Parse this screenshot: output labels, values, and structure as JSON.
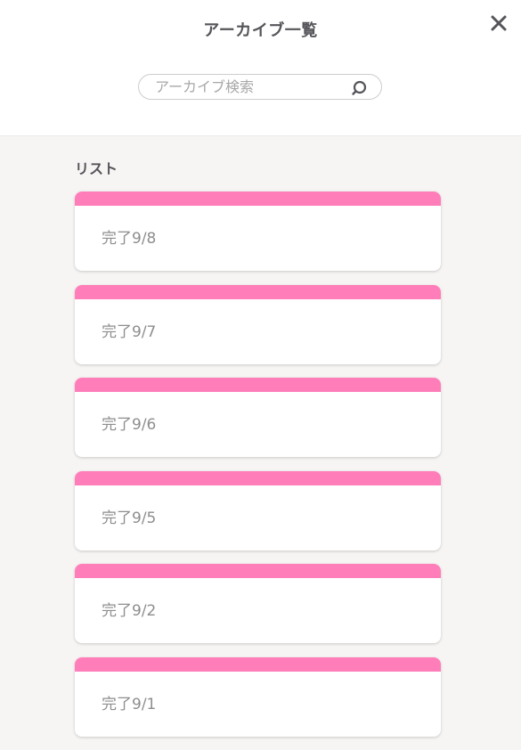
{
  "header": {
    "title": "アーカイブ一覧",
    "close_icon": "close-icon"
  },
  "search": {
    "placeholder": "アーカイブ検索",
    "value": "",
    "icon": "search-icon"
  },
  "list": {
    "heading": "リスト",
    "accent_color": "#ff7eb9",
    "items": [
      {
        "label": "完了9/8"
      },
      {
        "label": "完了9/7"
      },
      {
        "label": "完了9/6"
      },
      {
        "label": "完了9/5"
      },
      {
        "label": "完了9/2"
      },
      {
        "label": "完了9/1"
      }
    ]
  }
}
